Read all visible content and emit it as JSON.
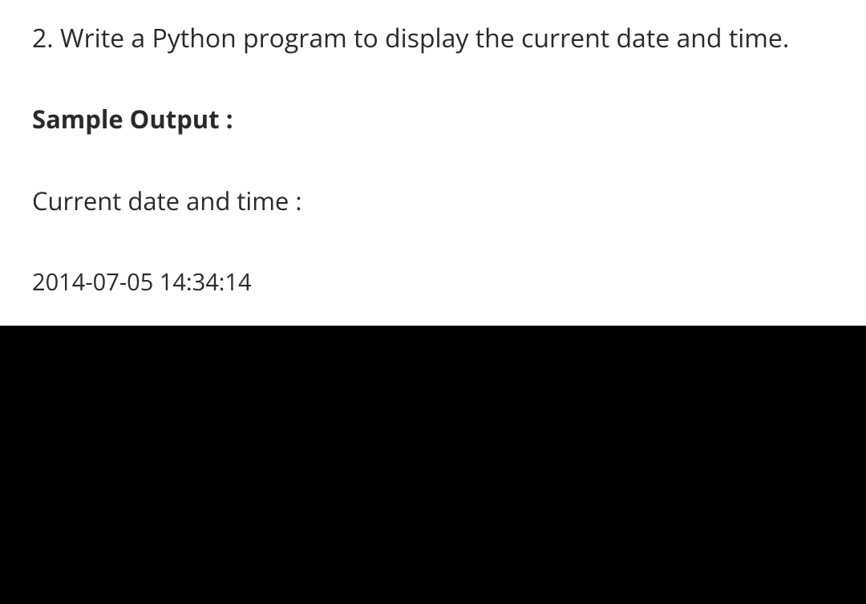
{
  "question": {
    "text": "2. Write a Python program to display the current date and time."
  },
  "sample_output": {
    "label": "Sample Output :",
    "header": "Current date and time :",
    "value": "2014-07-05 14:34:14"
  }
}
